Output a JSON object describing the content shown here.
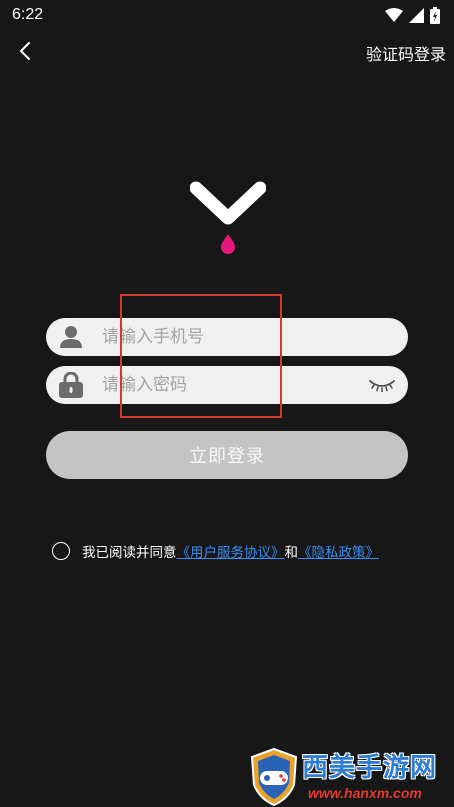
{
  "status_bar": {
    "time": "6:22",
    "icons": [
      "wifi-icon",
      "signal-icon",
      "battery-icon"
    ]
  },
  "header": {
    "back_icon": "chevron-left-icon",
    "code_login_label": "验证码登录"
  },
  "logo": {
    "icon": "chevron-drop-logo",
    "accent_color": "#e8177a"
  },
  "form": {
    "phone": {
      "icon": "user-icon",
      "placeholder": "请输入手机号",
      "value": ""
    },
    "password": {
      "icon": "lock-icon",
      "placeholder": "请输入密码",
      "value": "",
      "toggle_icon": "eye-closed-icon"
    },
    "login_label": "立即登录"
  },
  "agreement": {
    "checked": false,
    "prefix": "我已阅读并同意",
    "user_agreement": "《用户服务协议》",
    "conjunction": "和",
    "privacy_policy": "《隐私政策》"
  },
  "watermark": {
    "title": "西美手游网",
    "url": "www.hanxm.com"
  },
  "colors": {
    "background": "#171717",
    "input_bg": "#f0f0f0",
    "button_bg": "#c4c4c4",
    "link": "#3d8cf0",
    "highlight": "#d33a2c"
  }
}
